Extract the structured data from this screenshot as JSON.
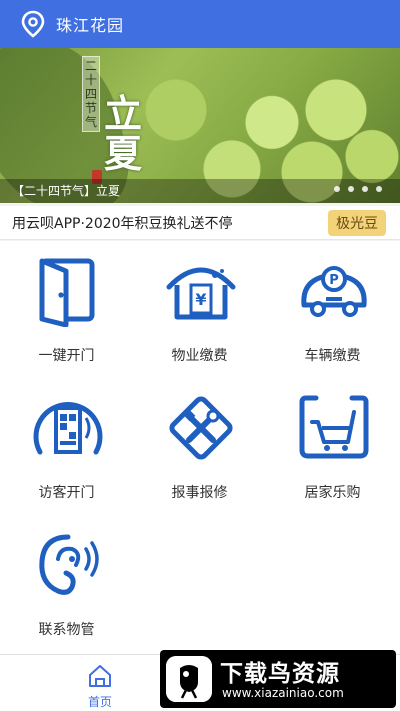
{
  "header": {
    "title": "珠江花园",
    "icon": "location-pin-icon"
  },
  "banner": {
    "vertical_text": "二十四节气",
    "big_text": "立夏",
    "caption": "【二十四节气】立夏",
    "page_count": 4
  },
  "notice": {
    "text": "用云呗APP·2020年积豆换礼送不停",
    "badge": "极光豆"
  },
  "services": [
    {
      "label": "一键开门",
      "icon": "door-open-icon"
    },
    {
      "label": "物业缴费",
      "icon": "house-payment-icon"
    },
    {
      "label": "车辆缴费",
      "icon": "car-parking-icon"
    },
    {
      "label": "访客开门",
      "icon": "visitor-qr-door-icon"
    },
    {
      "label": "报事报修",
      "icon": "repair-tools-icon"
    },
    {
      "label": "居家乐购",
      "icon": "shopping-cart-icon"
    },
    {
      "label": "联系物管",
      "icon": "contact-ear-icon"
    }
  ],
  "tabbar": {
    "home_label": "首页",
    "home_icon": "home-icon"
  },
  "watermark": {
    "title": "下载鸟资源",
    "url": "www.xiazainiao.com"
  },
  "colors": {
    "primary": "#3f6fe0",
    "icon_blue": "#1f5fbf",
    "badge": "#f3d37a"
  }
}
